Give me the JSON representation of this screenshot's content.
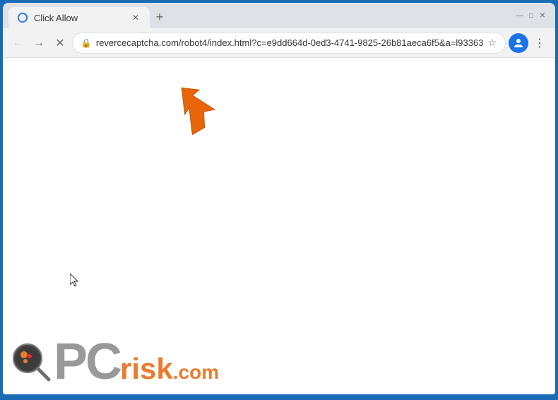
{
  "browser": {
    "tab": {
      "title": "Click Allow",
      "favicon": "circle-icon"
    },
    "new_tab_label": "+",
    "window_controls": {
      "minimize": "—",
      "maximize": "□",
      "close": "✕"
    },
    "toolbar": {
      "back_button": "←",
      "forward_button": "→",
      "reload_button": "✕",
      "address": "revercecaptcha.com/robot4/index.html?c=e9dd664d-0ed3-4741-9825-26b81aeca6f5&a=l93363",
      "lock_icon": "🔒",
      "star_icon": "☆",
      "avatar_icon": "person",
      "menu_icon": "⋮"
    },
    "watermark": {
      "pc_text": "PC",
      "risk_text": "risk",
      "com_text": ".com"
    }
  }
}
